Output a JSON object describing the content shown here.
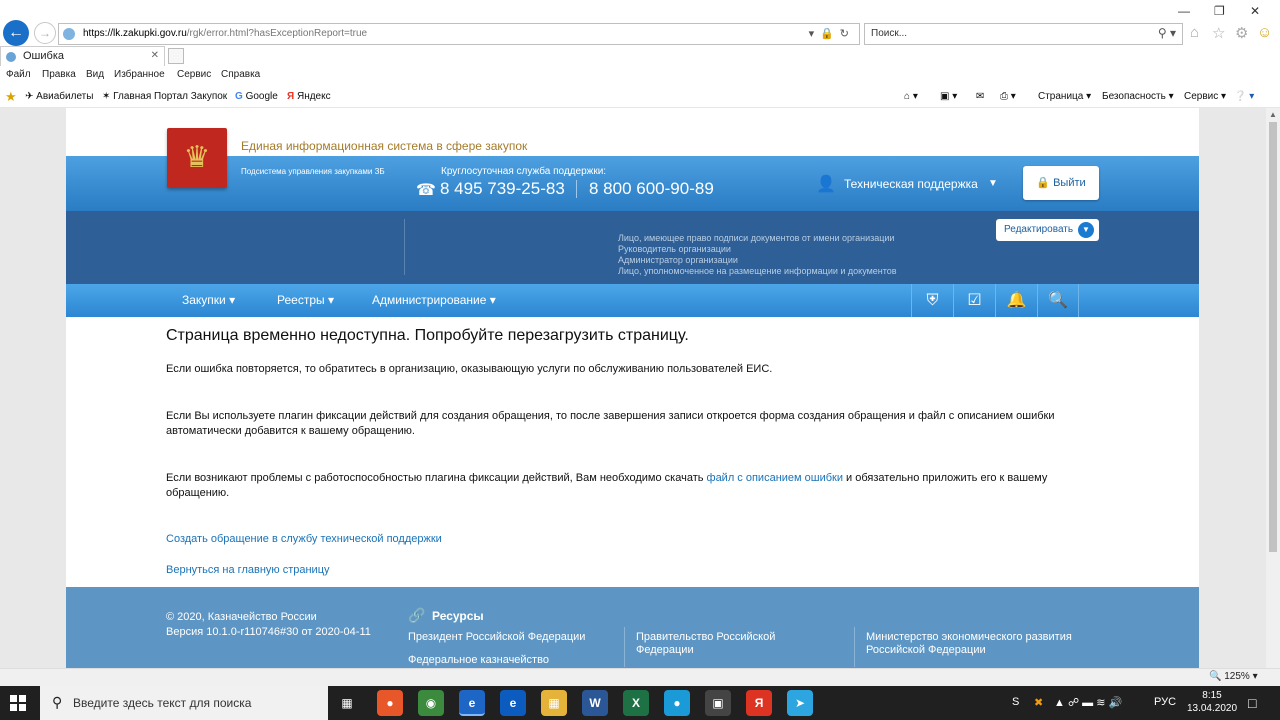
{
  "browser": {
    "url_domain": "https://lk.zakupki.gov.ru",
    "url_path": "/rgk/error.html?hasExceptionReport=true",
    "search_placeholder": "Поиск...",
    "tab_title": "Ошибка",
    "menu": [
      "Файл",
      "Правка",
      "Вид",
      "Избранное",
      "Сервис",
      "Справка"
    ],
    "favorites": [
      "Авиабилеты",
      "Главная Портал Закупок",
      "Google",
      "Яндекс"
    ],
    "commands": [
      "Страница",
      "Безопасность",
      "Сервис"
    ],
    "zoom": "125%"
  },
  "header": {
    "title": "Единая информационная система в сфере закупок",
    "subsystem": "Подсистема управления закупками ЗБ",
    "support_label": "Круглосуточная служба поддержки:",
    "phone1": "8 495 739-25-83",
    "phone2": "8 800 600-90-89",
    "tech_support": "Техническая поддержка",
    "logout": "Выйти",
    "edit": "Редактировать",
    "roles": [
      "Лицо, имеющее право подписи документов от имени организации",
      "Руководитель организации",
      "Администратор организации",
      "Лицо, уполномоченное на размещение информации и документов"
    ]
  },
  "nav": {
    "items": [
      "Закупки",
      "Реестры",
      "Администрирование"
    ]
  },
  "main": {
    "heading": "Страница временно недоступна. Попробуйте перезагрузить страницу.",
    "p1": "Если ошибка повторяется, то обратитесь в организацию, оказывающую услуги по обслуживанию пользователей ЕИС.",
    "p2": "Если Вы используете плагин фиксации действий для создания обращения, то после завершения записи откроется форма создания обращения и файл с описанием ошибки автоматически добавится к вашему обращению.",
    "p3_before": "Если возникают проблемы с работоспособностью плагина фиксации действий, Вам необходимо скачать ",
    "p3_link": "файл с описанием ошибки",
    "p3_after": " и обязательно приложить его к вашему обращению.",
    "link_support": "Создать обращение в службу технической поддержки",
    "link_home": "Вернуться на главную страницу"
  },
  "footer": {
    "copyright": "© 2020, Казначейство России",
    "version": "Версия 10.1.0-r110746#30 от 2020-04-11",
    "resources_title": "Ресурсы",
    "res1": "Президент Российской Федерации",
    "res2": "Федеральное казначейство",
    "res3": "Правительство Российской Федерации",
    "res4": "Министерство экономического развития Российской Федерации"
  },
  "taskbar": {
    "search_placeholder": "Введите здесь текст для поиска",
    "lang": "РУС",
    "time": "8:15",
    "date": "13.04.2020"
  }
}
